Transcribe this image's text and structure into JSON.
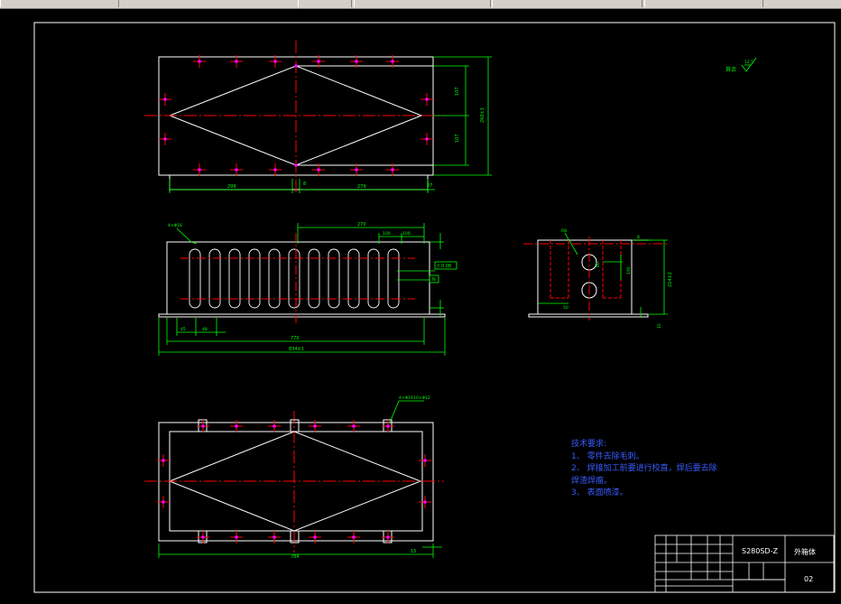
{
  "toolbar": {
    "items": [
      "",
      "",
      "",
      "",
      "",
      ""
    ]
  },
  "roughness": {
    "label": "其余",
    "value": "12.5"
  },
  "top_view": {
    "dims": {
      "left": "299",
      "mid": "8",
      "right": "279",
      "end": "27",
      "h_total": "260±1",
      "h_upper": "107",
      "h_lower": "107"
    }
  },
  "front_view": {
    "dims": {
      "top": "270",
      "top_a": "100",
      "top_b": "100",
      "pitch_a": "45",
      "pitch_b": "48",
      "total": "770",
      "overall": "834±1",
      "left_leader": "4×Φ16"
    },
    "frame_tags": [
      "// 0.08",
      "N"
    ]
  },
  "side_view": {
    "dims": {
      "r": "R8",
      "width": "80",
      "slot": "190",
      "height": "224±2",
      "small": "10",
      "edge_a": "50",
      "edge_b": "8"
    }
  },
  "bottom_view": {
    "dims": {
      "leader_a": "4×Φ16",
      "leader_b": "10×Φ12",
      "width": "784",
      "right": "15"
    }
  },
  "notes": {
    "title": "技术要求:",
    "items": [
      "1、 零件去除毛刺。",
      "2、 焊接加工前要进行校直，焊后要去除",
      "焊渣焊瘤。",
      "3、 表面喷漆。"
    ]
  },
  "title_block": {
    "code": "S280SD-Z",
    "name": "外箱体",
    "number": "02"
  },
  "colors": {
    "bg": "#000000",
    "outline": "#ffffff",
    "center": "#ff0000",
    "dim": "#00ff00",
    "text": "#3a5bff",
    "mark": "#ff00ff"
  }
}
